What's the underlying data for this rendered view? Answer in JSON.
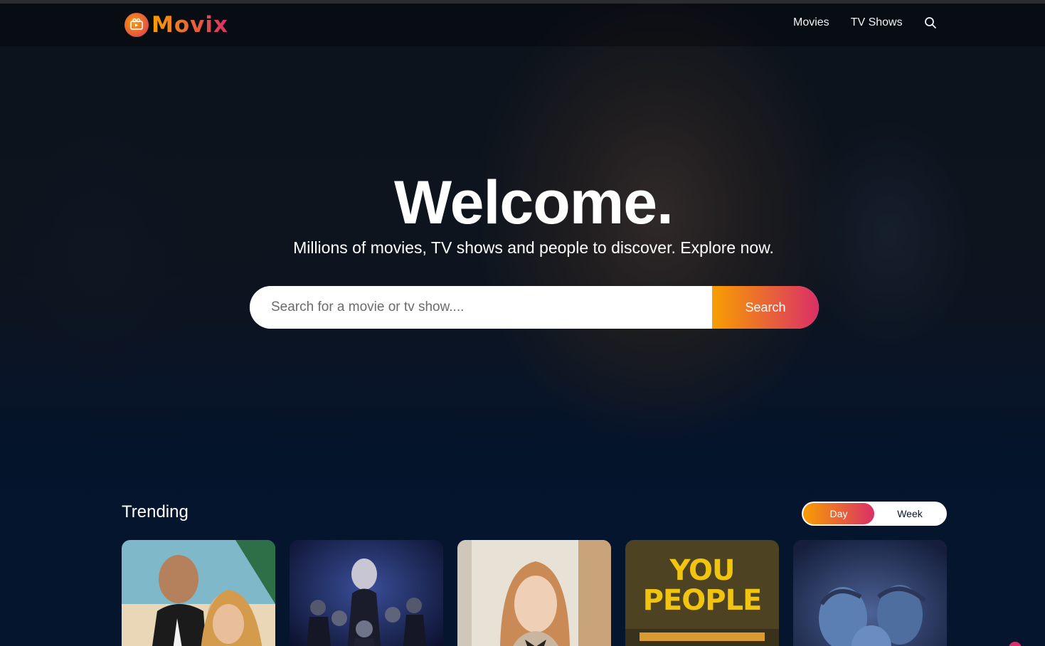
{
  "header": {
    "logo_text": "Movix",
    "nav": [
      {
        "label": "Movies"
      },
      {
        "label": "TV Shows"
      }
    ],
    "search_icon": "search-icon"
  },
  "hero": {
    "title": "Welcome.",
    "subtitle": "Millions of movies, TV shows and people to discover. Explore now.",
    "search": {
      "placeholder": "Search for a movie or tv show....",
      "button_label": "Search"
    }
  },
  "trending": {
    "title": "Trending",
    "tabs": [
      {
        "label": "Day",
        "active": true
      },
      {
        "label": "Week",
        "active": false
      }
    ],
    "cards": [
      {
        "poster_text": ""
      },
      {
        "poster_text": ""
      },
      {
        "poster_text": ""
      },
      {
        "poster_text": "YOU PEOPLE"
      },
      {
        "poster_text": ""
      }
    ]
  },
  "colors": {
    "background": "#04152d",
    "accent_start": "#f89e00",
    "accent_end": "#da2f68"
  }
}
